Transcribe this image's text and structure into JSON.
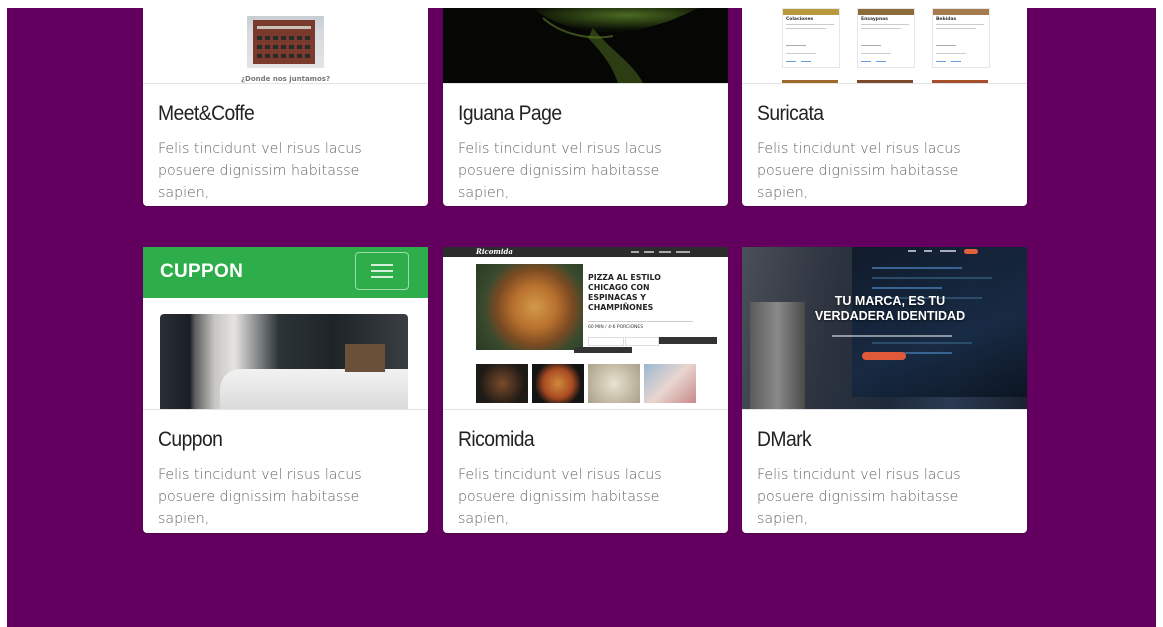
{
  "colors": {
    "background": "#63005f",
    "card": "#ffffff",
    "cuppon_green": "#2ead4b"
  },
  "cards": [
    {
      "title": "Meet&Coffe",
      "description": "Felis tincidunt vel risus lacus posuere dignissim habitasse sapien,",
      "thumb_caption": "¿Donde nos juntamos?"
    },
    {
      "title": "Iguana Page",
      "description": "Felis tincidunt vel risus lacus posuere dignissim habitasse sapien,"
    },
    {
      "title": "Suricata",
      "description": "Felis tincidunt vel risus lacus posuere dignissim habitasse sapien,",
      "thumb_labels": [
        "Colaciones",
        "Ensaypnos",
        "Bebidas"
      ]
    },
    {
      "title": "Cuppon",
      "description": "Felis tincidunt vel risus lacus posuere dignissim habitasse sapien,",
      "thumb_brand": "CUPPON"
    },
    {
      "title": "Ricomida",
      "description": "Felis tincidunt vel risus lacus posuere dignissim habitasse sapien,",
      "thumb_brand": "Ricomida",
      "thumb_heading": "PIZZA AL ESTILO CHICAGO CON ESPINACAS Y CHAMPIÑONES",
      "thumb_meta": "60 MIN / 4-6 PORCIONES"
    },
    {
      "title": "DMark",
      "description": "Felis tincidunt vel risus lacus posuere dignissim habitasse sapien,",
      "thumb_heading": "TU MARCA, ES TU VERDADERA IDENTIDAD"
    }
  ]
}
